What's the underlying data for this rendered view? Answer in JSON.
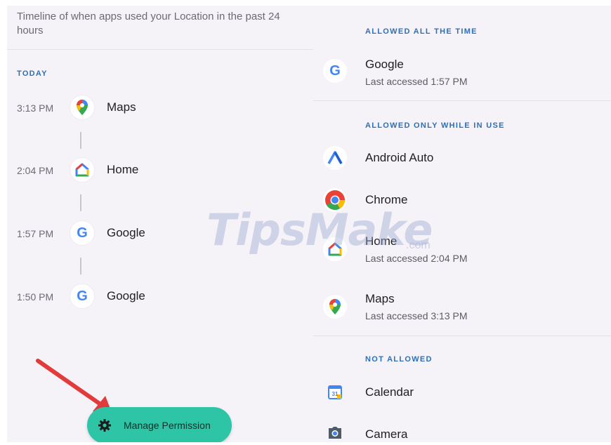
{
  "left_panel": {
    "description": "Timeline of when apps used your Location in the past 24 hours",
    "section_label": "TODAY",
    "timeline": [
      {
        "time": "3:13 PM",
        "app": "Maps",
        "icon": "maps-icon"
      },
      {
        "time": "2:04 PM",
        "app": "Home",
        "icon": "home-icon"
      },
      {
        "time": "1:57 PM",
        "app": "Google",
        "icon": "google-icon"
      },
      {
        "time": "1:50 PM",
        "app": "Google",
        "icon": "google-icon"
      }
    ],
    "fab": {
      "label": "Manage Permission",
      "icon": "gear-icon"
    }
  },
  "right_panel": {
    "sections": [
      {
        "label": "ALLOWED ALL THE TIME",
        "apps": [
          {
            "name": "Google",
            "subtitle": "Last accessed 1:57 PM",
            "icon": "google-icon"
          }
        ]
      },
      {
        "label": "ALLOWED ONLY WHILE IN USE",
        "apps": [
          {
            "name": "Android Auto",
            "icon": "android-auto-icon"
          },
          {
            "name": "Chrome",
            "icon": "chrome-icon"
          },
          {
            "name": "Home",
            "subtitle": "Last accessed 2:04 PM",
            "icon": "home-icon"
          },
          {
            "name": "Maps",
            "subtitle": "Last accessed 3:13 PM",
            "icon": "maps-icon"
          }
        ]
      },
      {
        "label": "NOT ALLOWED",
        "apps": [
          {
            "name": "Calendar",
            "icon": "calendar-icon"
          },
          {
            "name": "Camera",
            "icon": "camera-icon"
          }
        ]
      }
    ]
  },
  "watermark": {
    "text": "TipsMake",
    "suffix": ".com"
  },
  "colors": {
    "background": "#f5f2f8",
    "section_label": "#2f6fb6",
    "fab": "#2ec4a6",
    "arrow": "#e23b3b"
  }
}
